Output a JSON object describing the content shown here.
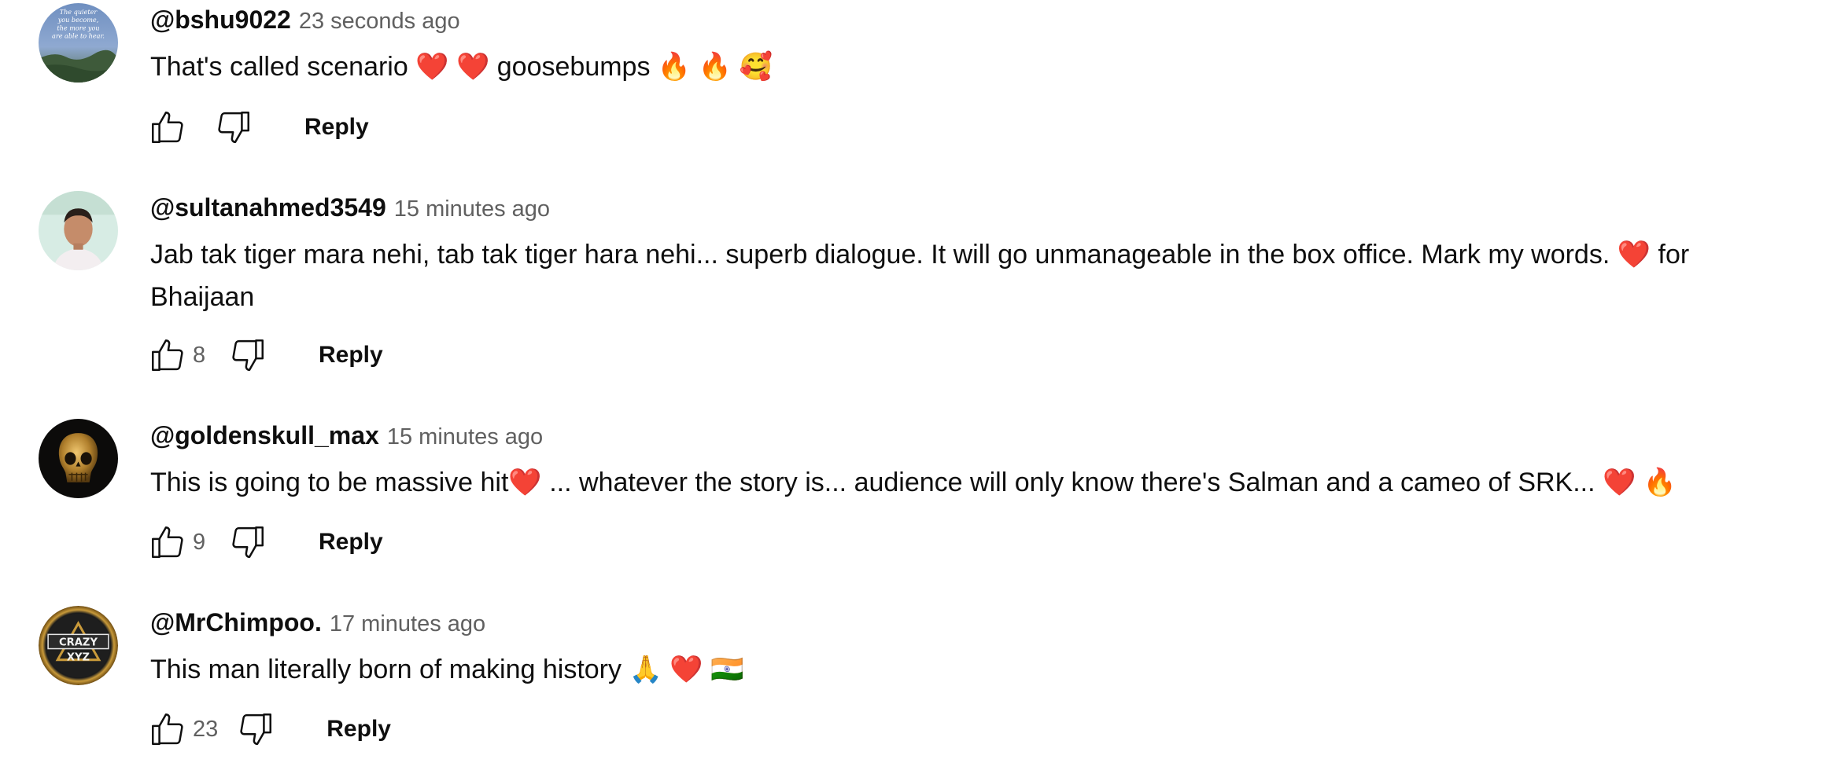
{
  "comments": [
    {
      "author": "@bshu9022",
      "time": "23 seconds ago",
      "text": "That's called scenario ❤️ ❤️ goosebumps 🔥 🔥 🥰",
      "likes": "",
      "reply_label": "Reply",
      "avatar_text": "The quieter you become, the more you are able to hear."
    },
    {
      "author": "@sultanahmed3549",
      "time": "15 minutes ago",
      "text": "Jab tak tiger mara nehi, tab tak tiger hara nehi... superb dialogue. It will go unmanageable in the box office. Mark my words. ❤️ for Bhaijaan",
      "likes": "8",
      "reply_label": "Reply"
    },
    {
      "author": "@goldenskull_max",
      "time": "15 minutes ago",
      "text": "This is going to be massive hit❤️ ... whatever the story is... audience will only know there's Salman and a cameo of SRK... ❤️ 🔥",
      "likes": "9",
      "reply_label": "Reply"
    },
    {
      "author": "@MrChimpoo.",
      "time": "17 minutes ago",
      "text": "This man literally born of making history 🙏 ❤️ 🇮🇳",
      "likes": "23",
      "reply_label": "Reply",
      "avatar_text": "CRAZY XYZ"
    }
  ],
  "icons": {
    "like": "thumbs-up-icon",
    "dislike": "thumbs-down-icon"
  },
  "colors": {
    "text": "#0f0f0f",
    "secondary": "#606060"
  }
}
